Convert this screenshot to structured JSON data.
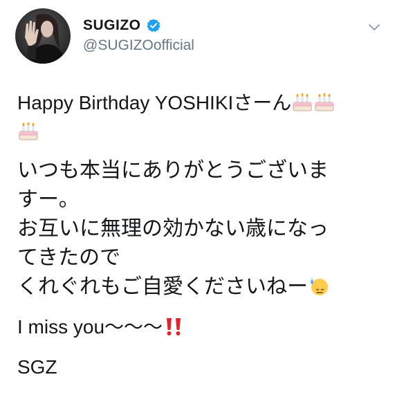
{
  "tweet": {
    "author": {
      "display_name": "SUGIZO",
      "handle": "@SUGIZOofficial",
      "verified": true,
      "avatar_icon": "avatar-photo"
    },
    "menu_icon": "chevron-down-icon",
    "lines": {
      "l1": "Happy Birthday YOSHIKIさーん",
      "l3": "いつも本当にありがとうございま",
      "l4": "すー。",
      "l5": "お互いに無理の効かない歳になっ",
      "l6": "てきたので",
      "l7": "くれぐれもご自愛くださいねー",
      "l8": "I miss you〜〜〜",
      "l9": "SGZ"
    },
    "emoji": [
      "birthday-cake",
      "birthday-cake",
      "birthday-cake",
      "sweat-face",
      "double-exclamation"
    ],
    "colors": {
      "text": "#14171a",
      "secondary": "#657786",
      "verified_blue": "#1da1f2",
      "exclamation_red": "#e0242d"
    }
  }
}
